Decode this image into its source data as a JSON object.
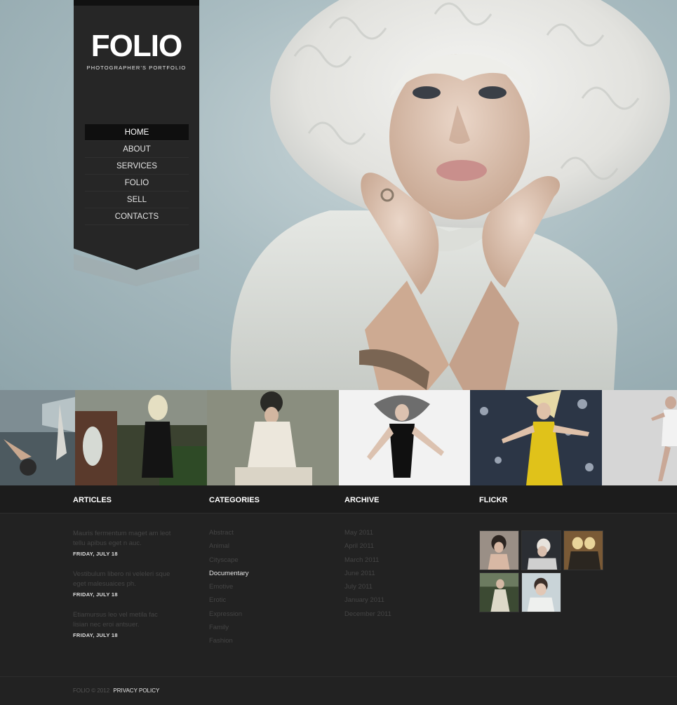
{
  "header": {
    "logo": "FOLIO",
    "tagline": "PHOTOGRAPHER'S PORTFOLIO"
  },
  "nav": {
    "items": [
      {
        "label": "HOME",
        "active": true
      },
      {
        "label": "ABOUT"
      },
      {
        "label": "SERVICES"
      },
      {
        "label": "FOLIO"
      },
      {
        "label": "SELL"
      },
      {
        "label": "CONTACTS"
      }
    ]
  },
  "footer": {
    "articles": {
      "title": "ARTICLES",
      "items": [
        {
          "text": "Mauris fermentum maget am leot tellu apibus eget n auc.",
          "date": "FRIDAY, JULY 18"
        },
        {
          "text": "Vestibulum libero ni veleleri sque eget malesuaices ph.",
          "date": "FRIDAY, JULY 18"
        },
        {
          "text": "Etiamursus leo vel metila fac lisian nec eroi antsuer.",
          "date": "FRIDAY, JULY 18"
        }
      ]
    },
    "categories": {
      "title": "CATEGORIES",
      "items": [
        "Abstract",
        "Animal",
        "Cityscape",
        "Documentary",
        "Emotive",
        "Erotic",
        "Expression",
        "Family",
        "Fashion"
      ],
      "highlighted": "Documentary"
    },
    "archive": {
      "title": "ARCHIVE",
      "items": [
        "May 2011",
        "April 2011",
        "March 2011",
        "June 2011",
        "July 2011",
        "January 2011",
        "December 2011"
      ]
    },
    "flickr": {
      "title": "FLICKR"
    },
    "copyright": "FOLIO © 2012",
    "privacy": "PRIVACY POLICY"
  }
}
